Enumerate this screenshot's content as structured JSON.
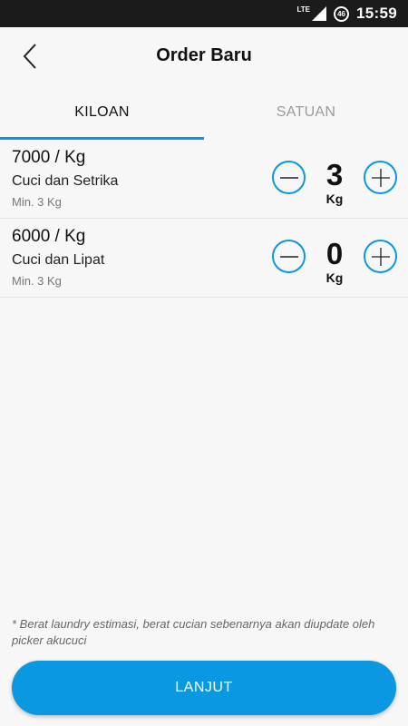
{
  "status_bar": {
    "network": "LTE",
    "battery": "46",
    "time": "15:59"
  },
  "header": {
    "title": "Order Baru",
    "back_icon": "chevron-left-icon"
  },
  "tabs": [
    {
      "label": "KILOAN",
      "active": true
    },
    {
      "label": "SATUAN",
      "active": false
    }
  ],
  "items": [
    {
      "price": "7000 / Kg",
      "service": "Cuci dan Setrika",
      "minimum": "Min. 3 Kg",
      "quantity": "3",
      "unit": "Kg"
    },
    {
      "price": "6000 / Kg",
      "service": "Cuci dan Lipat",
      "minimum": "Min. 3 Kg",
      "quantity": "0",
      "unit": "Kg"
    }
  ],
  "note": "* Berat laundry estimasi, berat cucian sebenarnya akan diupdate oleh picker akucuci",
  "footer": {
    "next_label": "LANJUT"
  },
  "colors": {
    "accent": "#0a98e0",
    "background": "#f7f7f7",
    "status_bar": "#1b1b1b"
  }
}
